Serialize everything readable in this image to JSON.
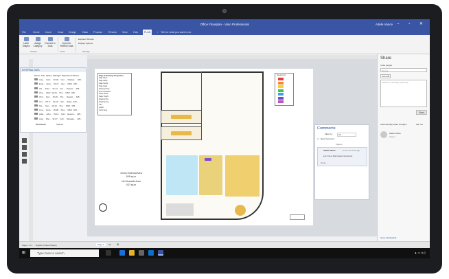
{
  "window": {
    "title": "Office Floorplan - Visio Professional",
    "user": "Adele Vance",
    "controls": "– ▫ ✕"
  },
  "tabs": [
    "File",
    "Home",
    "Insert",
    "Draw",
    "Design",
    "Data",
    "Process",
    "Review",
    "View",
    "Help",
    "PLAN"
  ],
  "tell_me": "Tell me what you want to do",
  "ribbon": {
    "buttons": [
      "Label Shapes",
      "Assign Category",
      "Connect to Data",
      "Import to Refresh Data"
    ],
    "items": [
      "Explorer Window",
      "Display Options"
    ],
    "groups": [
      "Shapes",
      "Data",
      "Manage"
    ]
  },
  "data_pane": {
    "title": "EXTERNAL DATA",
    "columns": [
      "Name",
      "Title",
      "Space",
      "Manager",
      "Department",
      "Phone"
    ],
    "rows": [
      [
        "Ang...",
        "Cont...",
        "W-18..",
        "Con...",
        "Marketi...",
        "425..."
      ],
      [
        "Emp...",
        "Emp...",
        "W-17..",
        "Qur...",
        "R&D",
        "425..."
      ],
      [
        "Ale...",
        "Ente...",
        "W-14..",
        "Jon...",
        "Operat...",
        "425..."
      ],
      [
        "Che...",
        "CEO",
        "W-23..",
        "Pra...",
        "R&D",
        "425..."
      ],
      [
        "Chri...",
        "Sen...",
        "W-26..",
        "Pra...",
        "Operat...",
        "425..."
      ],
      [
        "Uni...",
        "VP S...",
        "W-19..",
        "Sar...",
        "Sales",
        "425..."
      ],
      [
        "Ste...",
        "Sen...",
        "W-21..",
        "Pra...",
        "R&D",
        "425..."
      ],
      [
        "Line...",
        "Emp...",
        "W-08..",
        "Des...",
        "R&D",
        "425..."
      ],
      [
        "Adel...",
        "Adm...",
        "W-11..",
        "Coll...",
        "Execut...",
        "425..."
      ],
      [
        "Ang...",
        "Pas...",
        "W-27..",
        "Coll...",
        "Manage...",
        "425..."
      ]
    ],
    "tabs": [
      "Personnel",
      "Spaces"
    ]
  },
  "props": {
    "title": "Page & Drawing Properties",
    "rows": [
      "Page Name",
      "Page Width",
      "Page Height",
      "Page Angle",
      "Drawing Scale",
      "Print Orientation",
      "Paper Width",
      "Paper Height",
      "Drawing Size",
      "Drawing Area",
      "Title",
      "Author",
      "Gross Area"
    ]
  },
  "area": {
    "gross_label": "Gross External Area",
    "gross": "545 sq.m",
    "net_label": "Net Useable Area",
    "net": "437 sq.m"
  },
  "legend_title": "Department",
  "comments": {
    "title": "Comments",
    "filter": "Filter by:",
    "filter_value": "All",
    "new": "New Comment",
    "page": "Page-1",
    "author": "Adele Vance",
    "time": "A few seconds ago",
    "text": "Let's do a final review tomorrow.",
    "reply": "Reply..."
  },
  "share": {
    "title": "Share",
    "invite": "Invite people",
    "invite_ph": "Names",
    "permission": "Can edit",
    "message_ph": "Include a message (optional)",
    "button": "Share",
    "auto": "Automatically share changes",
    "auto_value": "Ask me",
    "person": "Adele Vance",
    "role": "Owner",
    "link": "Get a sharing link"
  },
  "status": {
    "page": "Page 1 of 1",
    "lang": "English (United States)",
    "page_tab": "Page-1",
    "all": "All"
  },
  "taskbar": {
    "search": "Type here to search"
  },
  "colors": {
    "accent": "#3955a3",
    "legend": [
      "#e23c3c",
      "#f08a2c",
      "#f0d43a",
      "#4bbf4b",
      "#3aa4e0",
      "#6b4fc4",
      "#c04fc4"
    ]
  }
}
